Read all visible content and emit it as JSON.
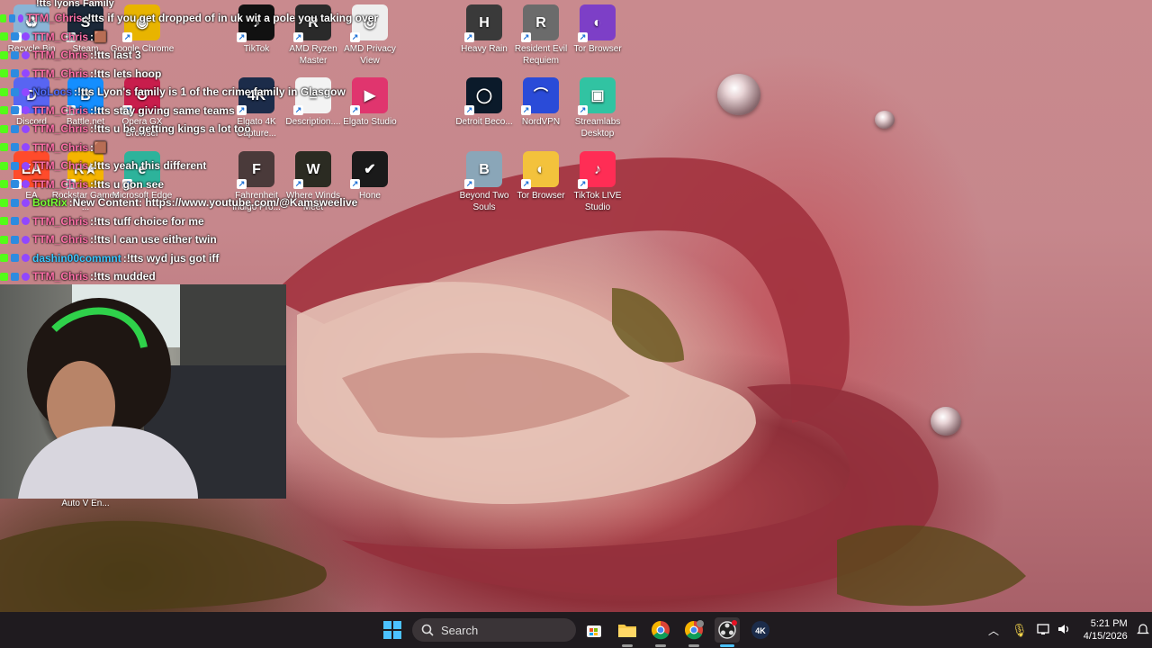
{
  "desktop": {
    "icons": [
      {
        "id": "recycle",
        "label": "Recycle Bin",
        "color": "#8ab4d6",
        "glyph": "♻"
      },
      {
        "id": "steam",
        "label": "Steam",
        "color": "#1b2838",
        "glyph": "S"
      },
      {
        "id": "chrome",
        "label": "Google Chrome",
        "color": "#e8b400",
        "glyph": "◉"
      },
      {
        "id": "tiktok",
        "label": "TikTok",
        "color": "#111111",
        "glyph": "♪"
      },
      {
        "id": "amd-ryzen",
        "label": "AMD Ryzen Master",
        "color": "#2a2a2a",
        "glyph": "R"
      },
      {
        "id": "amd-privacy",
        "label": "AMD Privacy View",
        "color": "#eeeeee",
        "glyph": "◎"
      },
      {
        "id": "heavy-rain",
        "label": "Heavy Rain",
        "color": "#3a3a3a",
        "glyph": "H"
      },
      {
        "id": "resident-evil",
        "label": "Resident Evil Requiem",
        "color": "#6b6b6b",
        "glyph": "R"
      },
      {
        "id": "tor-browser-1",
        "label": "Tor Browser",
        "color": "#7d3fc7",
        "glyph": "◐"
      },
      {
        "id": "discord",
        "label": "Discord",
        "color": "#5865f2",
        "glyph": "D"
      },
      {
        "id": "battlenet",
        "label": "Battle.net",
        "color": "#148eff",
        "glyph": "B"
      },
      {
        "id": "opera-gx",
        "label": "Opera GX Browser",
        "color": "#c81d4c",
        "glyph": "O"
      },
      {
        "id": "elgato-4k",
        "label": "Elgato 4K Capture...",
        "color": "#1c2c4a",
        "glyph": "4K"
      },
      {
        "id": "description",
        "label": "Description....",
        "color": "#f3f3f3",
        "glyph": "≡"
      },
      {
        "id": "elgato-studio",
        "label": "Elgato Studio",
        "color": "#e0356e",
        "glyph": "▶"
      },
      {
        "id": "detroit",
        "label": "Detroit Beco...",
        "color": "#0b1a2a",
        "glyph": "◯"
      },
      {
        "id": "nordvpn",
        "label": "NordVPN",
        "color": "#2a4bd8",
        "glyph": "⌒"
      },
      {
        "id": "streamlabs",
        "label": "Streamlabs Desktop",
        "color": "#31c3a2",
        "glyph": "▣"
      },
      {
        "id": "ea",
        "label": "EA",
        "color": "#ff4b2b",
        "glyph": "EA"
      },
      {
        "id": "rockstar",
        "label": "Rockstar Games ...",
        "color": "#f4b400",
        "glyph": "R★"
      },
      {
        "id": "edge",
        "label": "Microsoft Edge",
        "color": "#2db39b",
        "glyph": "e"
      },
      {
        "id": "fahrenheit",
        "label": "Fahrenheit Indigo Pro...",
        "color": "#4a3a3a",
        "glyph": "F"
      },
      {
        "id": "where-winds",
        "label": "Where Winds Meet",
        "color": "#2b2b22",
        "glyph": "W"
      },
      {
        "id": "hone",
        "label": "Hone",
        "color": "#1a1a1a",
        "glyph": "✔"
      },
      {
        "id": "beyond",
        "label": "Beyond Two Souls",
        "color": "#8aa6b8",
        "glyph": "B"
      },
      {
        "id": "tor-browser-2",
        "label": "Tor Browser",
        "color": "#f3c23c",
        "glyph": "◐"
      },
      {
        "id": "tiktok-live",
        "label": "TikTok LIVE Studio",
        "color": "#ff2d55",
        "glyph": "♪"
      },
      {
        "id": "auto",
        "label": "Auto V En...",
        "color": "#333333",
        "glyph": "A"
      }
    ]
  },
  "chat": {
    "header": "!tts lyons Family",
    "lines": [
      {
        "user": "TTM_Chris",
        "msg": "!tts if you get dropped of in uk wit a pole you taking over"
      },
      {
        "user": "TTM_Chris",
        "msg": "🟫"
      },
      {
        "user": "TTM_Chris",
        "msg": "!tts last 3"
      },
      {
        "user": "TTM_Chris",
        "msg": "!tts lets hoop"
      },
      {
        "user": "NoLocs",
        "msg": "!tts Lyon's family is 1 of the crime family in Glasgow"
      },
      {
        "user": "TTM_Chris",
        "msg": "!tts stay giving same teams"
      },
      {
        "user": "TTM_Chris",
        "msg": "!tts u be getting kings a lot too"
      },
      {
        "user": "TTM_Chris",
        "msg": "🟫"
      },
      {
        "user": "TTM_Chris",
        "msg": "!tts yeah this different"
      },
      {
        "user": "TTM_Chris",
        "msg": "!tts u gon see"
      },
      {
        "user": "BotRix",
        "msg": "New Content: https://www.youtube.com/@Kamsweelive"
      },
      {
        "user": "TTM_Chris",
        "msg": "!tts tuff choice for me"
      },
      {
        "user": "TTM_Chris",
        "msg": "!tts I can use either twin"
      },
      {
        "user": "dashin00commnt",
        "msg": "!tts wyd jus got iff"
      },
      {
        "user": "TTM_Chris",
        "msg": "!tts mudded"
      }
    ]
  },
  "taskbar": {
    "search_label": "Search",
    "time": "5:21 PM",
    "date": "4/15/2026"
  },
  "colors": {
    "user_ttm": "#ff6fa8",
    "user_botrix": "#79ff35",
    "user_dashin": "#3cc7ff",
    "user_nolocs": "#4d6bff"
  }
}
